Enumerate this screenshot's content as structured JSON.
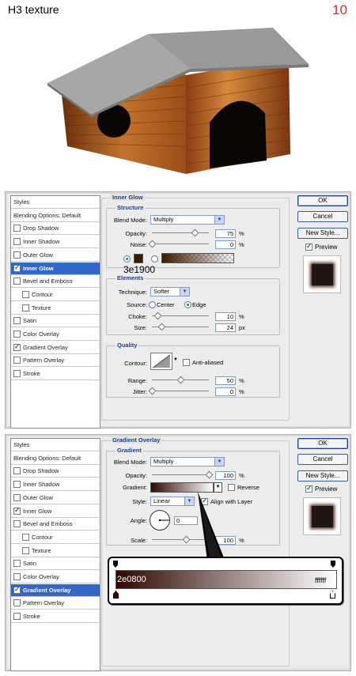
{
  "tutorial": {
    "title": "H3 texture",
    "step": "10"
  },
  "colors": {
    "glow": "#3e1900",
    "gradient_start": "#2e0800",
    "gradient_end": "#ffffff",
    "selected_row": "#3266c8",
    "step_number": "#e8231e"
  },
  "icons": [
    "checkbox-icon",
    "radio-icon",
    "dropdown-arrow-icon",
    "slider-knob-icon",
    "gradient-stop-icon",
    "contour-curve-icon",
    "angle-dial-icon"
  ],
  "buttons": {
    "ok": "OK",
    "cancel": "Cancel",
    "new_style": "New Style...",
    "preview": "Preview"
  },
  "panel1": {
    "styles": [
      {
        "label": "Styles",
        "type": "head"
      },
      {
        "label": "Blending Options: Default",
        "type": "head"
      },
      {
        "label": "Drop Shadow",
        "checked": false
      },
      {
        "label": "Inner Shadow",
        "checked": false
      },
      {
        "label": "Outer Glow",
        "checked": false
      },
      {
        "label": "Inner Glow",
        "checked": true,
        "selected": true
      },
      {
        "label": "Bevel and Emboss",
        "checked": false
      },
      {
        "label": "Contour",
        "checked": false,
        "indent": true
      },
      {
        "label": "Texture",
        "checked": false,
        "indent": true
      },
      {
        "label": "Satin",
        "checked": false
      },
      {
        "label": "Color Overlay",
        "checked": false
      },
      {
        "label": "Gradient Overlay",
        "checked": true
      },
      {
        "label": "Pattern Overlay",
        "checked": false
      },
      {
        "label": "Stroke",
        "checked": false
      }
    ],
    "section": "Inner Glow",
    "structure": {
      "title": "Structure",
      "blend_mode_label": "Blend Mode:",
      "blend_mode": "Multiply",
      "opacity_label": "Opacity:",
      "opacity": "75",
      "opacity_unit": "%",
      "noise_label": "Noise:",
      "noise": "0",
      "noise_unit": "%",
      "color_hex": "3e1900"
    },
    "elements": {
      "title": "Elements",
      "technique_label": "Technique:",
      "technique": "Softer",
      "source_label": "Source:",
      "source_center": "Center",
      "source_edge": "Edge",
      "choke_label": "Choke:",
      "choke": "10",
      "choke_unit": "%",
      "size_label": "Size:",
      "size": "24",
      "size_unit": "px"
    },
    "quality": {
      "title": "Quality",
      "contour_label": "Contour:",
      "anti_aliased": "Anti-aliased",
      "range_label": "Range:",
      "range": "50",
      "range_unit": "%",
      "jitter_label": "Jitter:",
      "jitter": "0",
      "jitter_unit": "%"
    },
    "sliders": {
      "opacity": 0.75,
      "noise": 0.0,
      "choke": 0.1,
      "size": 0.16,
      "range": 0.5,
      "jitter": 0.0
    }
  },
  "panel2": {
    "styles": [
      {
        "label": "Styles",
        "type": "head"
      },
      {
        "label": "Blending Options: Default",
        "type": "head"
      },
      {
        "label": "Drop Shadow",
        "checked": false
      },
      {
        "label": "Inner Shadow",
        "checked": false
      },
      {
        "label": "Outer Glow",
        "checked": false
      },
      {
        "label": "Inner Glow",
        "checked": true
      },
      {
        "label": "Bevel and Emboss",
        "checked": false
      },
      {
        "label": "Contour",
        "checked": false,
        "indent": true
      },
      {
        "label": "Texture",
        "checked": false,
        "indent": true
      },
      {
        "label": "Satin",
        "checked": false
      },
      {
        "label": "Color Overlay",
        "checked": false
      },
      {
        "label": "Gradient Overlay",
        "checked": true,
        "selected": true
      },
      {
        "label": "Pattern Overlay",
        "checked": false
      },
      {
        "label": "Stroke",
        "checked": false
      }
    ],
    "section": "Gradient Overlay",
    "gradient": {
      "title": "Gradient",
      "blend_mode_label": "Blend Mode:",
      "blend_mode": "Multiply",
      "opacity_label": "Opacity:",
      "opacity": "100",
      "opacity_unit": "%",
      "gradient_label": "Gradient:",
      "reverse": "Reverse",
      "style_label": "Style:",
      "style": "Linear",
      "align": "Align with Layer",
      "angle_label": "Angle:",
      "angle": "0",
      "scale_label": "Scale:",
      "scale": "100",
      "scale_unit": "%"
    },
    "sliders": {
      "opacity": 1.0,
      "scale": 0.6
    },
    "stops": {
      "left": "2e0800",
      "right": "ffffff"
    }
  }
}
